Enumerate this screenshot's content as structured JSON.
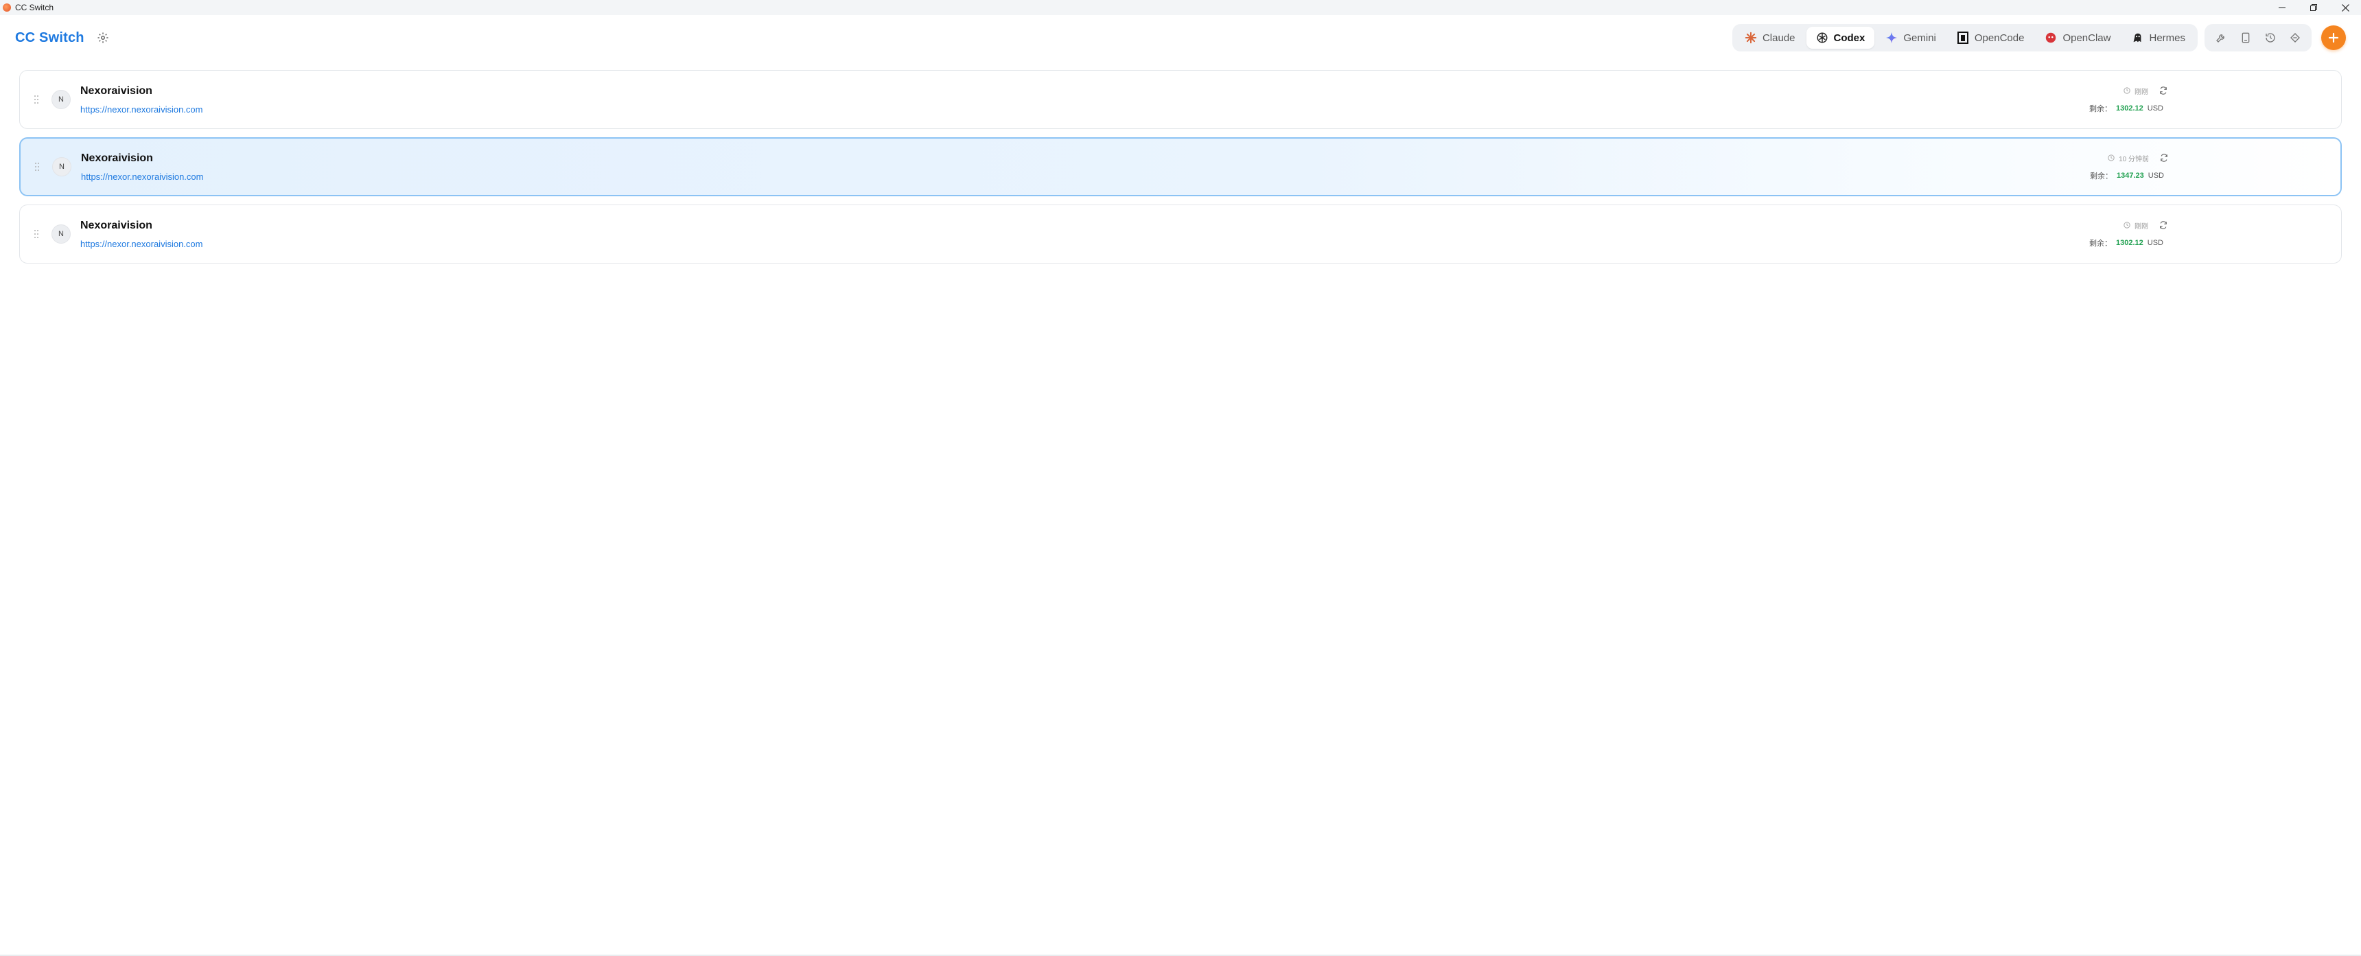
{
  "window": {
    "title": "CC Switch"
  },
  "header": {
    "brand": "CC Switch"
  },
  "tabs": [
    {
      "label": "Claude",
      "icon": "claude-icon",
      "active": false
    },
    {
      "label": "Codex",
      "icon": "codex-icon",
      "active": true
    },
    {
      "label": "Gemini",
      "icon": "gemini-icon",
      "active": false
    },
    {
      "label": "OpenCode",
      "icon": "opencode-icon",
      "active": false
    },
    {
      "label": "OpenClaw",
      "icon": "openclaw-icon",
      "active": false
    },
    {
      "label": "Hermes",
      "icon": "hermes-icon",
      "active": false
    }
  ],
  "tools": [
    "wrench-icon",
    "device-icon",
    "history-icon",
    "sync-icon"
  ],
  "providers": [
    {
      "initial": "N",
      "name": "Nexoraivision",
      "url": "https://nexor.nexoraivision.com",
      "status": "刚刚",
      "balance_label": "剩余：",
      "balance": "1302.12",
      "currency": "USD",
      "active": false
    },
    {
      "initial": "N",
      "name": "Nexoraivision",
      "url": "https://nexor.nexoraivision.com",
      "status": "10 分钟前",
      "balance_label": "剩余：",
      "balance": "1347.23",
      "currency": "USD",
      "active": true
    },
    {
      "initial": "N",
      "name": "Nexoraivision",
      "url": "https://nexor.nexoraivision.com",
      "status": "刚刚",
      "balance_label": "剩余：",
      "balance": "1302.12",
      "currency": "USD",
      "active": false
    }
  ],
  "colors": {
    "brand": "#1f7ae0",
    "accent": "#f5841f",
    "balance": "#20a050",
    "active_border": "#8cc3f4"
  }
}
